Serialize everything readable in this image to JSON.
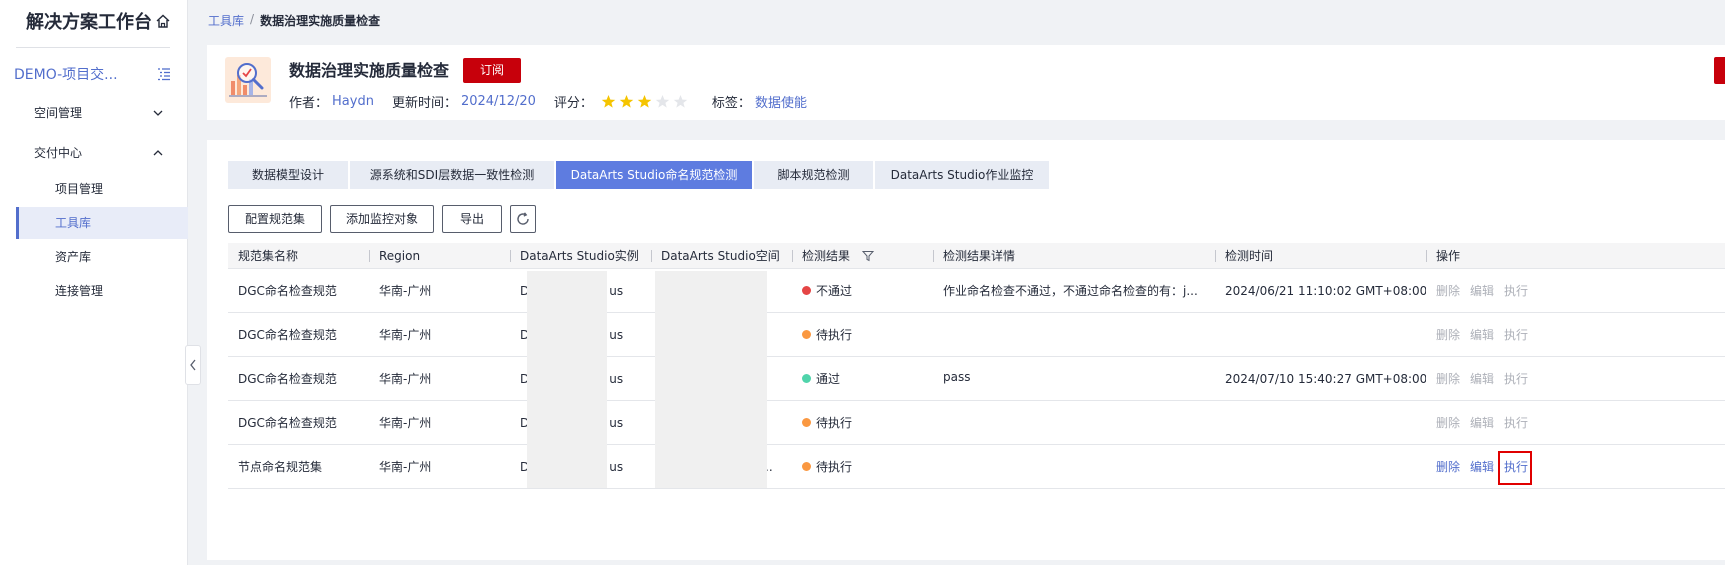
{
  "sidebar": {
    "title": "解决方案工作台",
    "project": "DEMO-项目交...",
    "groups": {
      "space": "空间管理",
      "delivery": "交付中心"
    },
    "items": [
      "项目管理",
      "工具库",
      "资产库",
      "连接管理"
    ],
    "active_item": "工具库"
  },
  "breadcrumb": {
    "root": "工具库",
    "separator": "/",
    "current": "数据治理实施质量检查"
  },
  "header": {
    "title": "数据治理实施质量检查",
    "subscribe_label": "订阅",
    "author_label": "作者：",
    "author": "Haydn",
    "updated_label": "更新时间：",
    "updated": "2024/12/20",
    "rating_label": "评分：",
    "rating": 3,
    "rating_max": 5,
    "tags_label": "标签：",
    "tag": "数据使能"
  },
  "tabs": [
    {
      "label": "数据模型设计"
    },
    {
      "label": "源系统和SDI层数据一致性检测"
    },
    {
      "label": "DataArts Studio命名规范检测"
    },
    {
      "label": "脚本规范检测"
    },
    {
      "label": "DataArts Studio作业监控"
    }
  ],
  "active_tab": 2,
  "toolbar": {
    "config_label": "配置规范集",
    "add_label": "添加监控对象",
    "export_label": "导出"
  },
  "table": {
    "columns": [
      "规范集名称",
      "Region",
      "DataArts Studio实例",
      "DataArts Studio空间",
      "检测结果",
      "检测结果详情",
      "检测时间",
      "操作"
    ],
    "rows": [
      {
        "name": "DGC命名检查规范",
        "region": "华南-广州",
        "instance_start": "D",
        "instance_end": "us",
        "space_end": "",
        "status": "不通过",
        "status_color": "#e54545",
        "detail": "作业命名检查不通过，不通过命名检查的有：j...",
        "time": "2024/06/21 11:10:02 GMT+08:00",
        "ops_active": false
      },
      {
        "name": "DGC命名检查规范",
        "region": "华南-广州",
        "instance_start": "D",
        "instance_end": "us",
        "space_end": "",
        "status": "待执行",
        "status_color": "#fa9841",
        "detail": "",
        "time": "",
        "ops_active": false
      },
      {
        "name": "DGC命名检查规范",
        "region": "华南-广州",
        "instance_start": "D",
        "instance_end": "us",
        "space_end": "",
        "status": "通过",
        "status_color": "#50d4ab",
        "detail": "pass",
        "time": "2024/07/10 15:40:27 GMT+08:00",
        "ops_active": false
      },
      {
        "name": "DGC命名检查规范",
        "region": "华南-广州",
        "instance_start": "D",
        "instance_end": "us",
        "space_end": "",
        "status": "待执行",
        "status_color": "#fa9841",
        "detail": "",
        "time": "",
        "ops_active": false
      },
      {
        "name": "节点命名规范集",
        "region": "华南-广州",
        "instance_start": "D",
        "instance_end": "us",
        "space_end": "..",
        "status": "待执行",
        "status_color": "#fa9841",
        "detail": "",
        "time": "",
        "ops_active": true
      }
    ],
    "ops": {
      "delete": "删除",
      "edit": "编辑",
      "run": "执行"
    }
  },
  "colors": {
    "accent": "#526ecc",
    "active_tab": "#5e7ce0",
    "brand_red": "#c7000b",
    "star": "#f5c400",
    "star_empty": "#e4e6ea",
    "highlight_box": "#e00000"
  }
}
